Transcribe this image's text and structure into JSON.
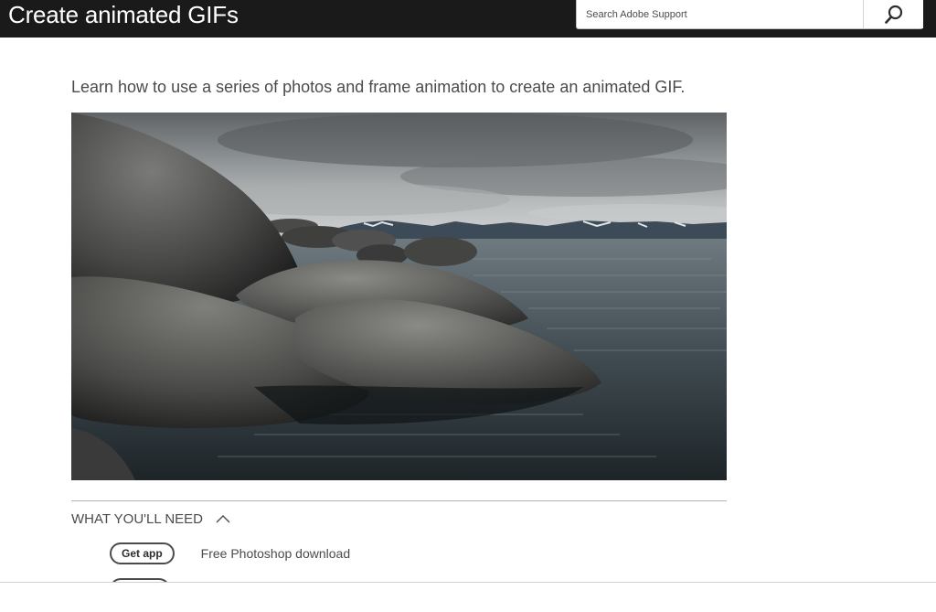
{
  "header": {
    "title": "Create animated GIFs",
    "background": "#1a1a1a",
    "search": {
      "placeholder": "Search Adobe Support",
      "value": "",
      "icon": "search-icon"
    }
  },
  "main": {
    "intro": "Learn how to use a series of photos and frame animation to create an animated GIF.",
    "hero_image": {
      "icon": "landscape-photo",
      "subject": "rocks-lake-mountains"
    },
    "what_you_need": {
      "label": "WHAT YOU'LL NEED",
      "expanded": true,
      "items": [
        {
          "button_label": "Get app",
          "text": "Free Photoshop download"
        }
      ]
    }
  },
  "colors": {
    "text_primary": "#4b4b4b",
    "header_bg": "#1a1a1a",
    "divider": "#b3b3b3"
  }
}
